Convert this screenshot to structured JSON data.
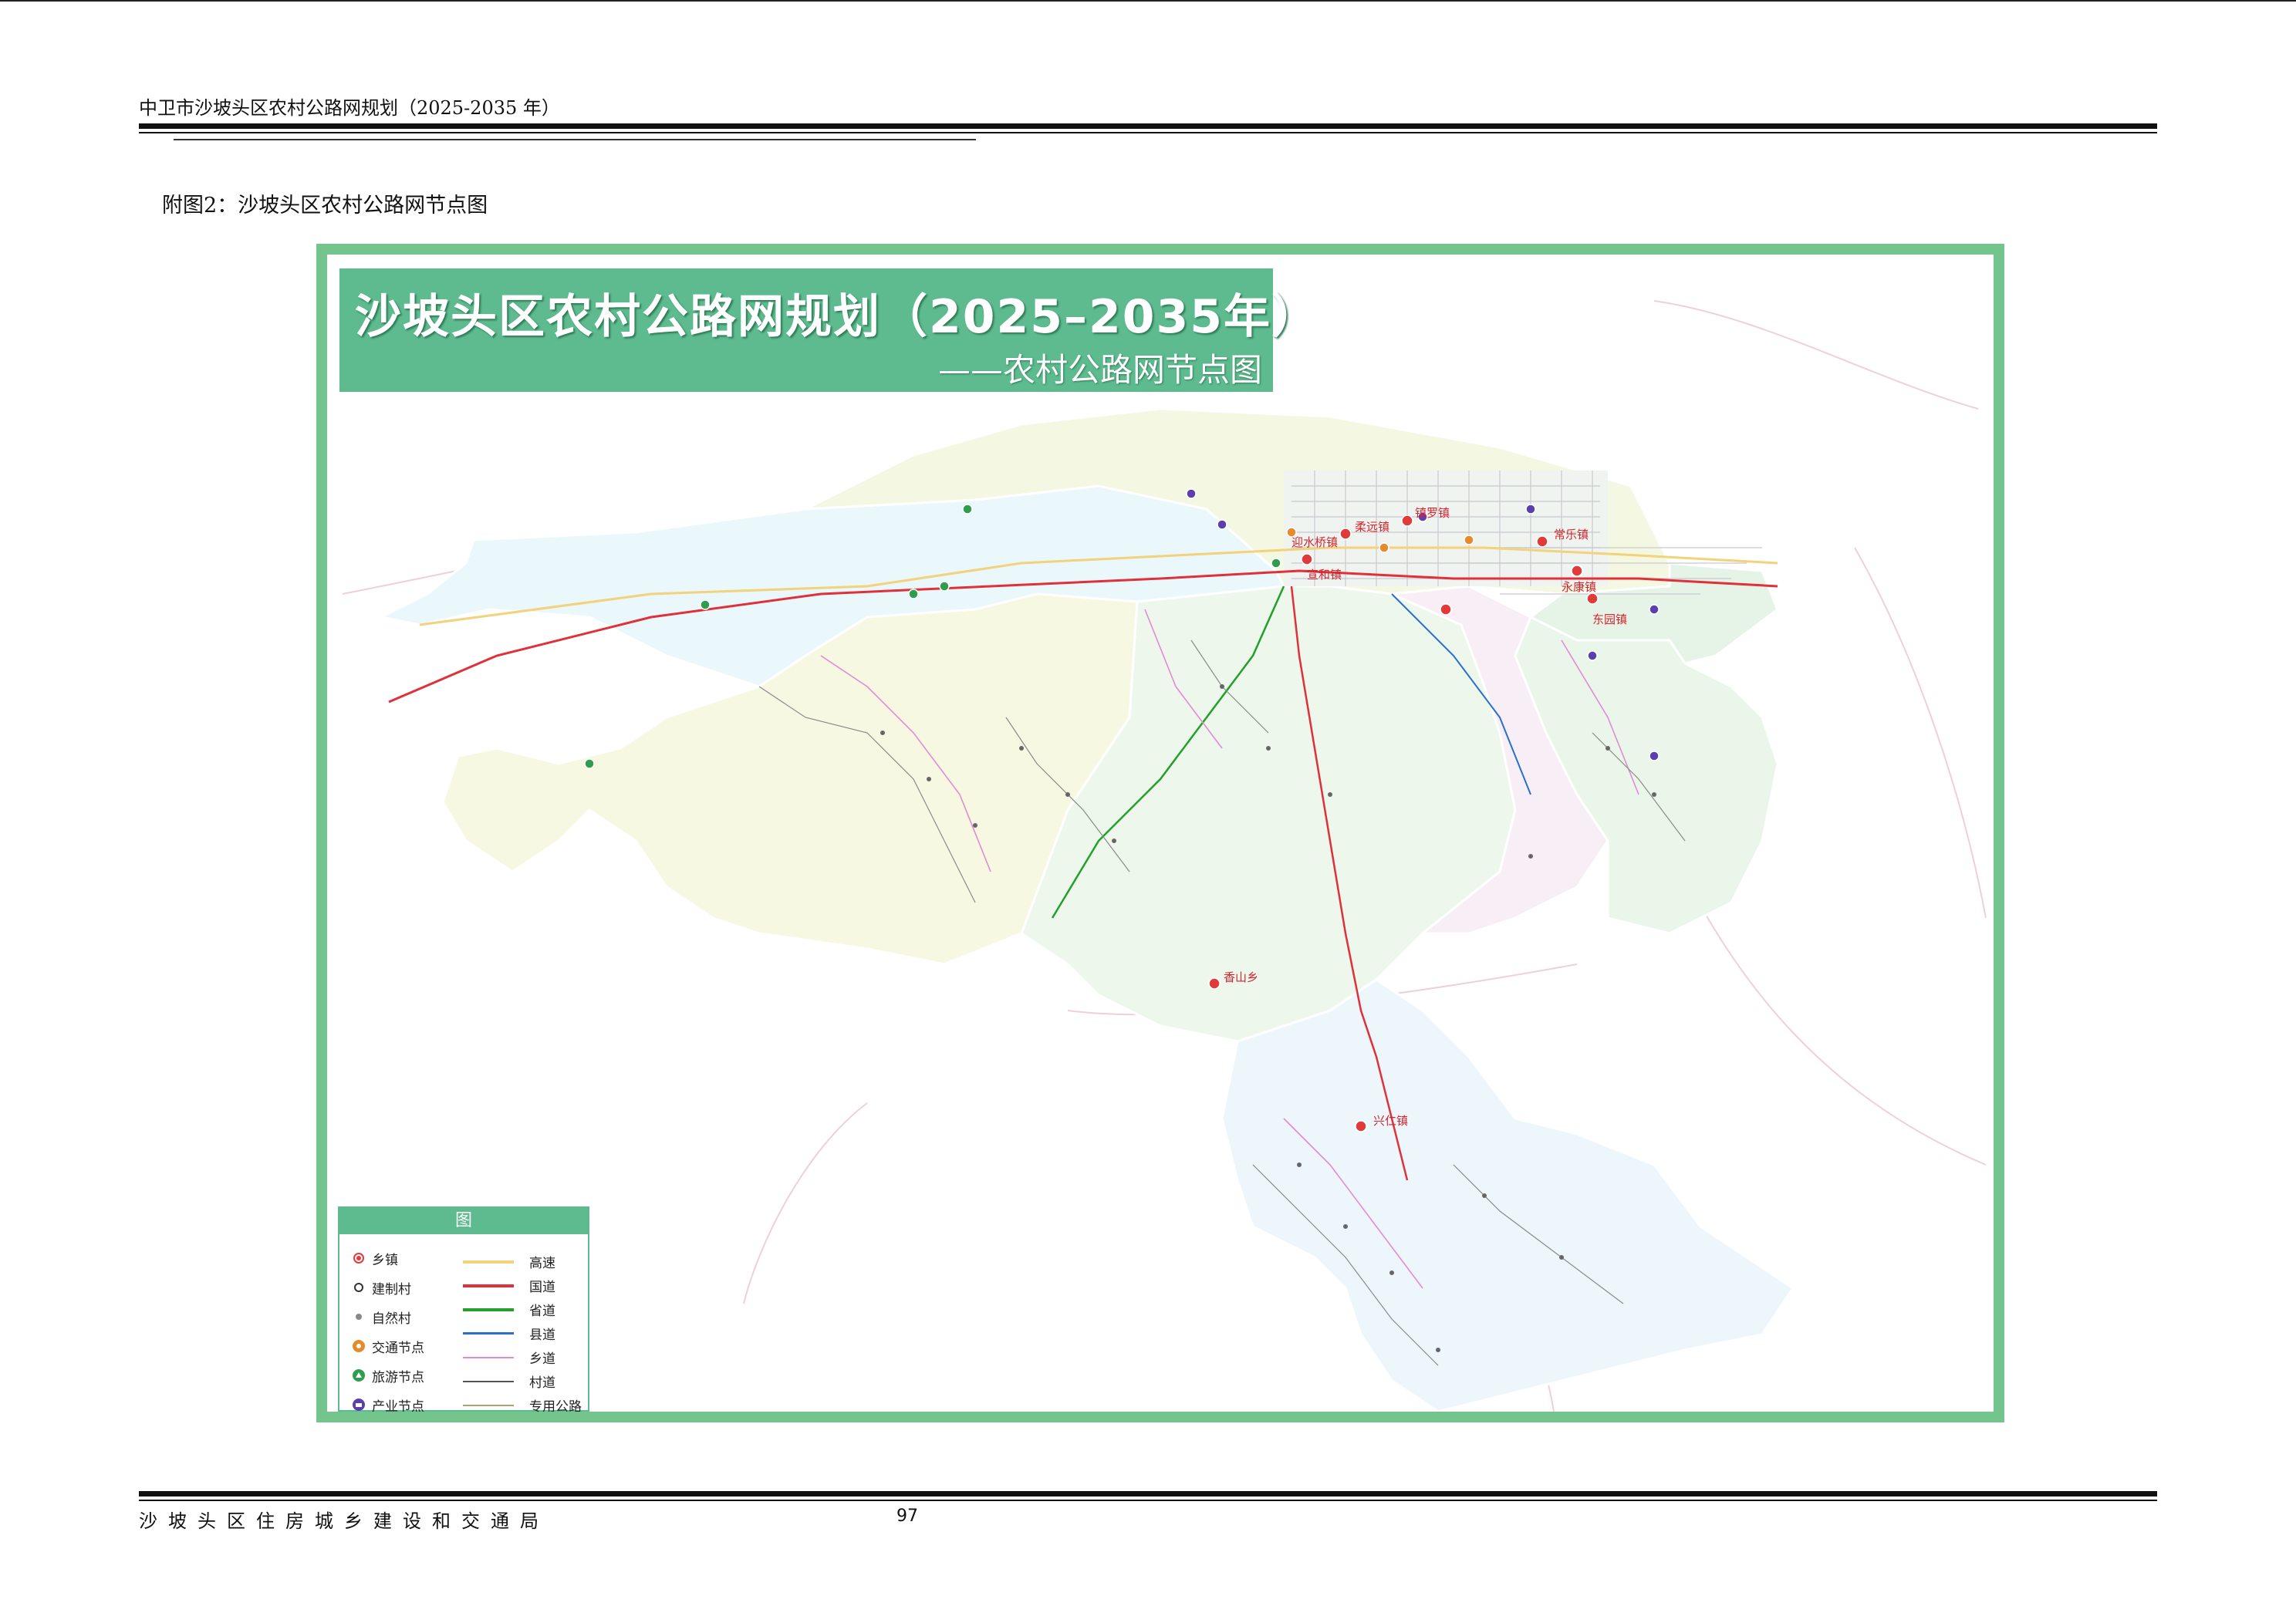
{
  "header": {
    "document_title": "中卫市沙坡头区农村公路网规划（2025-2035 年）"
  },
  "caption": "附图2：沙坡头区农村公路网节点图",
  "map": {
    "title": "沙坡头区农村公路网规划（2025–2035年）",
    "subtitle": "——农村公路网节点图",
    "town_labels": [
      "宣和镇",
      "迎水桥镇",
      "柔远镇",
      "镇罗镇",
      "常乐镇",
      "永康镇",
      "兴仁镇",
      "香山乡",
      "东园镇"
    ],
    "legend": {
      "title": "图 例",
      "points": [
        {
          "label": "乡镇",
          "color": "#e03a3a"
        },
        {
          "label": "建制村",
          "color": "#333333"
        },
        {
          "label": "自然村",
          "color": "#888888"
        },
        {
          "label": "交通节点",
          "color": "#e88a2c"
        },
        {
          "label": "旅游节点",
          "color": "#2e9e4e"
        },
        {
          "label": "产业节点",
          "color": "#5a3fb0"
        }
      ],
      "lines": [
        {
          "label": "高速",
          "color": "#f2d27a"
        },
        {
          "label": "国道",
          "color": "#e0303a"
        },
        {
          "label": "省道",
          "color": "#22a02a"
        },
        {
          "label": "县道",
          "color": "#2a6fd0"
        },
        {
          "label": "乡道",
          "color": "#e48ad6"
        },
        {
          "label": "村道",
          "color": "#555555"
        },
        {
          "label": "专用公路",
          "color": "#b0a070"
        }
      ]
    }
  },
  "footer": {
    "organization": "沙坡头区住房城乡建设和交通局",
    "page_number": "97"
  }
}
